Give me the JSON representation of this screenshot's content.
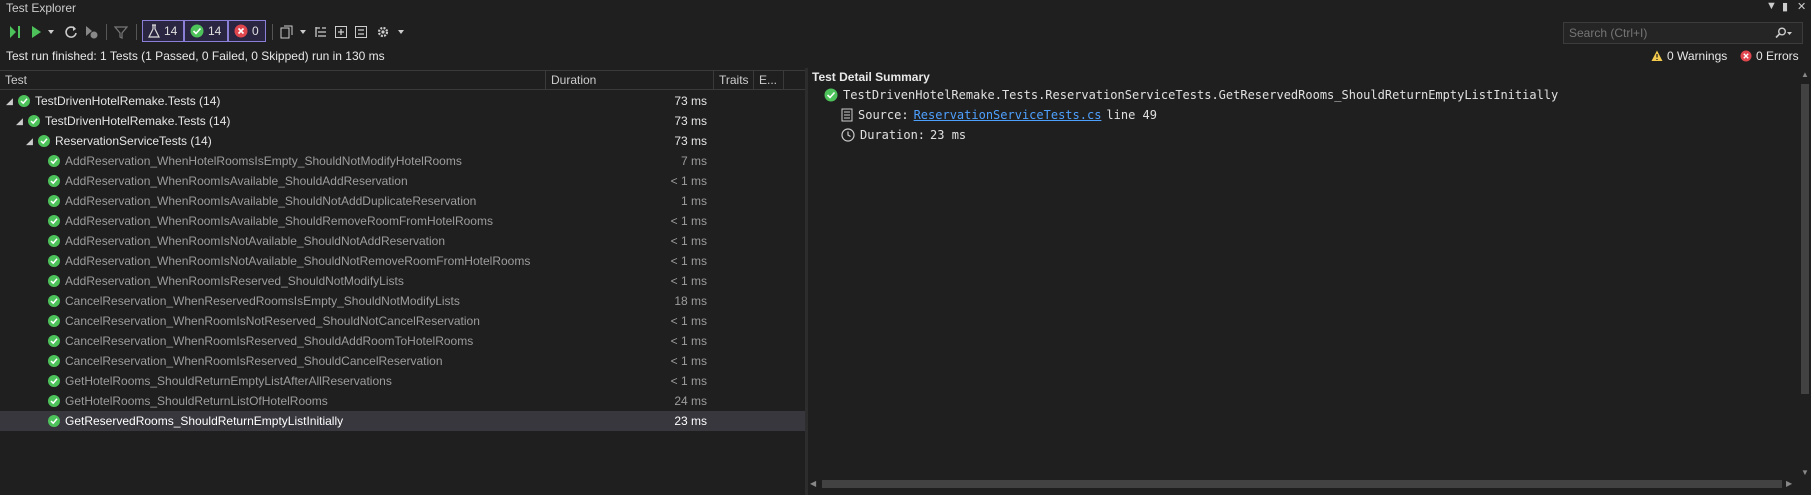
{
  "window": {
    "title": "Test Explorer"
  },
  "toolbar": {
    "counts": {
      "total": "14",
      "passed": "14",
      "failed": "0"
    }
  },
  "search": {
    "placeholder": "Search (Ctrl+I)"
  },
  "status": {
    "summary": "Test run finished: 1 Tests (1 Passed, 0 Failed, 0 Skipped) run in 130 ms",
    "warnings": "0 Warnings",
    "errors": "0 Errors"
  },
  "columns": {
    "test": "Test",
    "duration": "Duration",
    "traits": "Traits",
    "error": "E..."
  },
  "tree": [
    {
      "name": "TestDrivenHotelRemake.Tests (14)",
      "duration": "73 ms",
      "level": 0,
      "type": "group"
    },
    {
      "name": "TestDrivenHotelRemake.Tests (14)",
      "duration": "73 ms",
      "level": 1,
      "type": "group"
    },
    {
      "name": "ReservationServiceTests (14)",
      "duration": "73 ms",
      "level": 2,
      "type": "group"
    },
    {
      "name": "AddReservation_WhenHotelRoomsIsEmpty_ShouldNotModifyHotelRooms",
      "duration": "7 ms",
      "level": 3,
      "type": "leaf"
    },
    {
      "name": "AddReservation_WhenRoomIsAvailable_ShouldAddReservation",
      "duration": "< 1 ms",
      "level": 3,
      "type": "leaf"
    },
    {
      "name": "AddReservation_WhenRoomIsAvailable_ShouldNotAddDuplicateReservation",
      "duration": "1 ms",
      "level": 3,
      "type": "leaf"
    },
    {
      "name": "AddReservation_WhenRoomIsAvailable_ShouldRemoveRoomFromHotelRooms",
      "duration": "< 1 ms",
      "level": 3,
      "type": "leaf"
    },
    {
      "name": "AddReservation_WhenRoomIsNotAvailable_ShouldNotAddReservation",
      "duration": "< 1 ms",
      "level": 3,
      "type": "leaf"
    },
    {
      "name": "AddReservation_WhenRoomIsNotAvailable_ShouldNotRemoveRoomFromHotelRooms",
      "duration": "< 1 ms",
      "level": 3,
      "type": "leaf"
    },
    {
      "name": "AddReservation_WhenRoomIsReserved_ShouldNotModifyLists",
      "duration": "< 1 ms",
      "level": 3,
      "type": "leaf"
    },
    {
      "name": "CancelReservation_WhenReservedRoomsIsEmpty_ShouldNotModifyLists",
      "duration": "18 ms",
      "level": 3,
      "type": "leaf"
    },
    {
      "name": "CancelReservation_WhenRoomIsNotReserved_ShouldNotCancelReservation",
      "duration": "< 1 ms",
      "level": 3,
      "type": "leaf"
    },
    {
      "name": "CancelReservation_WhenRoomIsReserved_ShouldAddRoomToHotelRooms",
      "duration": "< 1 ms",
      "level": 3,
      "type": "leaf"
    },
    {
      "name": "CancelReservation_WhenRoomIsReserved_ShouldCancelReservation",
      "duration": "< 1 ms",
      "level": 3,
      "type": "leaf"
    },
    {
      "name": "GetHotelRooms_ShouldReturnEmptyListAfterAllReservations",
      "duration": "< 1 ms",
      "level": 3,
      "type": "leaf"
    },
    {
      "name": "GetHotelRooms_ShouldReturnListOfHotelRooms",
      "duration": "24 ms",
      "level": 3,
      "type": "leaf"
    },
    {
      "name": "GetReservedRooms_ShouldReturnEmptyListInitially",
      "duration": "23 ms",
      "level": 3,
      "type": "leaf",
      "selected": true
    }
  ],
  "detail": {
    "heading": "Test Detail Summary",
    "test_name": "TestDrivenHotelRemake.Tests.ReservationServiceTests.GetReservedRooms_ShouldReturnEmptyListInitially",
    "source_label": "Source:",
    "source_file": "ReservationServiceTests.cs",
    "source_line": "line 49",
    "duration_label": "Duration:",
    "duration_value": "23 ms"
  },
  "colors": {
    "pass": "#4ec25a",
    "fail": "#e0464e",
    "accent": "#8a7fd6",
    "link": "#4ea0ff"
  }
}
